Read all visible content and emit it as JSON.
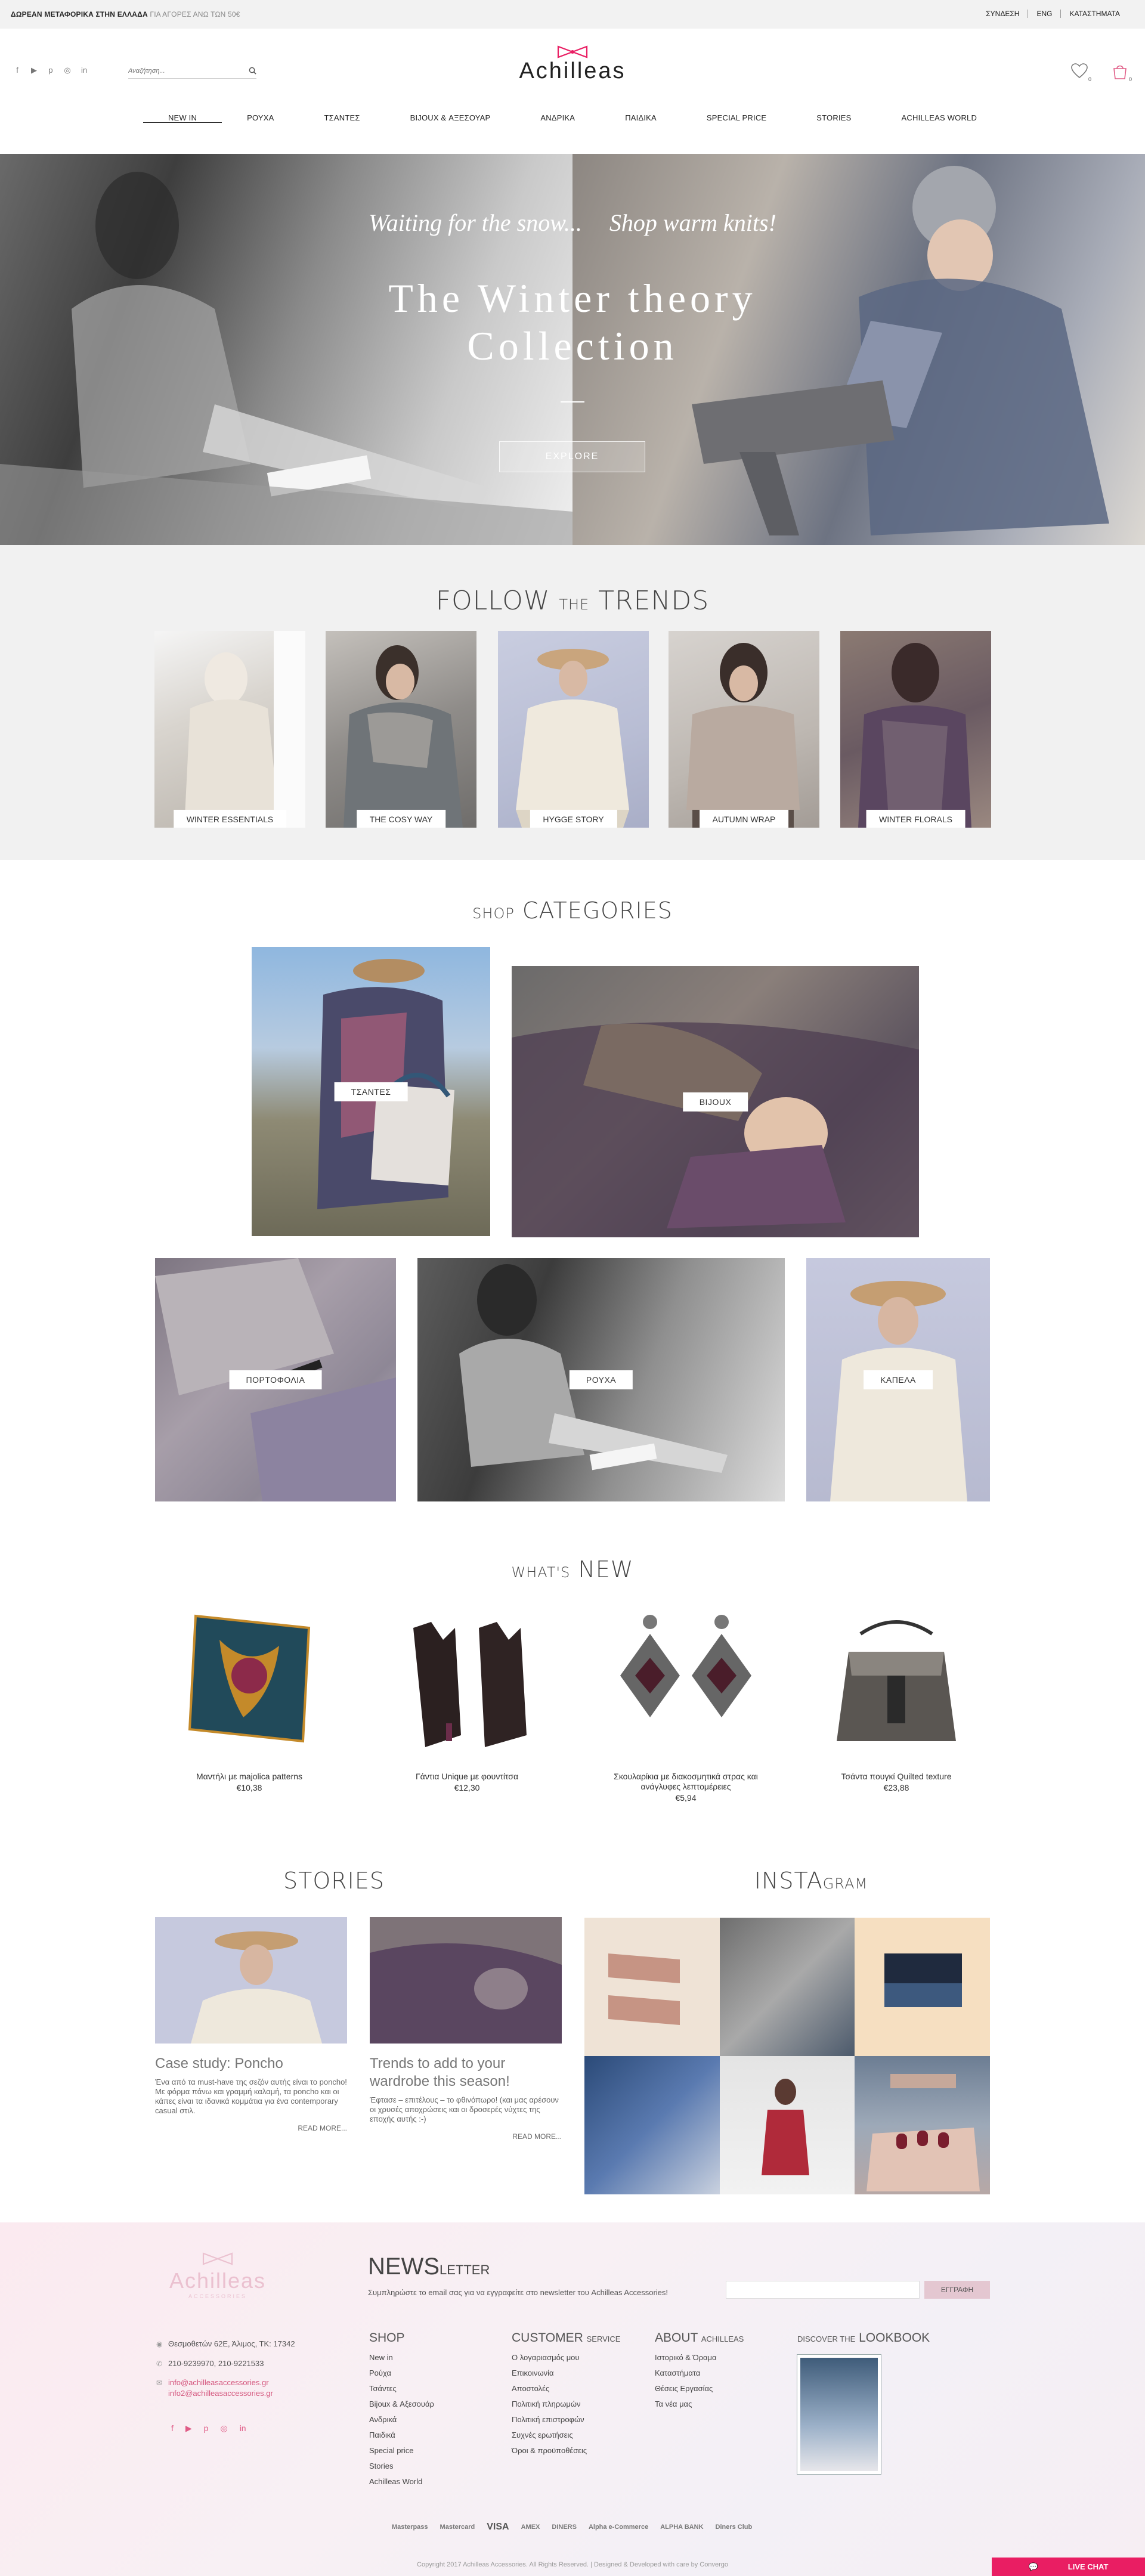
{
  "topbar": {
    "promo_bold": "ΔΩΡΕΑΝ ΜΕΤΑΦΟΡΙΚΑ ΣΤΗΝ ΕΛΛΑΔΑ",
    "promo_light": "ΓΙΑ ΑΓΟΡΕΣ ΑΝΩ ΤΩΝ 50€",
    "links": [
      "ΣΥΝΔΕΣΗ",
      "ENG",
      "ΚΑΤΑΣΤΗΜΑΤΑ"
    ]
  },
  "header": {
    "search_placeholder": "Αναζήτηση...",
    "logo_text": "Achilleas",
    "wishlist_count": "0",
    "cart_count": "0",
    "social_icons": [
      "facebook-icon",
      "youtube-icon",
      "pinterest-icon",
      "instagram-icon",
      "linkedin-icon"
    ],
    "nav": [
      "NEW IN",
      "ΡΟΥΧΑ",
      "ΤΣΑΝΤΕΣ",
      "BIJOUX & ΑΞΕΣΟΥΑΡ",
      "ΑΝΔΡΙΚΑ",
      "ΠΑΙΔΙΚΑ",
      "SPECIAL PRICE",
      "STORIES",
      "ACHILLEAS WORLD"
    ]
  },
  "hero": {
    "tagline_left": "Waiting for the snow...",
    "tagline_right": "Shop warm knits!",
    "title_line1": "The Winter theory",
    "title_line2": "Collection",
    "button": "EXPLORE"
  },
  "trends": {
    "title_big1": "FOLLOW",
    "title_small": "THE",
    "title_big2": "TRENDS",
    "cards": [
      "WINTER ESSENTIALS",
      "THE COSY WAY",
      "HYGGE STORY",
      "AUTUMN WRAP",
      "WINTER FLORALS"
    ]
  },
  "categories": {
    "title_small": "SHOP",
    "title_big": "CATEGORIES",
    "items": [
      "ΤΣΑΝΤΕΣ",
      "BIJOUX",
      "ΠΟΡΤΟΦΟΛΙΑ",
      "ΡΟΥΧΑ",
      "ΚΑΠΕΛΑ"
    ]
  },
  "whats_new": {
    "title_small": "WHAT'S",
    "title_big": "NEW",
    "products": [
      {
        "name": "Μαντήλι με majolica patterns",
        "price": "€10,38"
      },
      {
        "name": "Γάντια Unique με φουντίτσα",
        "price": "€12,30"
      },
      {
        "name": "Σκουλαρίκια με διακοσμητικά στρας και ανάγλυφες λεπτομέρειες",
        "price": "€5,94"
      },
      {
        "name": "Τσάντα πουγκί Quilted texture",
        "price": "€23,88"
      }
    ]
  },
  "stories": {
    "title": "STORIES",
    "items": [
      {
        "title": "Case study: Poncho",
        "excerpt": "Ένα από τα must-have της σεζόν αυτής είναι το poncho! Με φόρμα πάνω και γραμμή καλαμή, τα poncho και οι κάπες είναι τα ιδανικά κομμάτια για ένα contemporary casual στιλ.",
        "more": "READ MORE..."
      },
      {
        "title": "Trends to add to your wardrobe this season!",
        "excerpt": "Έφτασε – επιτέλους – το φθινόπωρο! (και μας αρέσουν οι χρυσές αποχρώσεις και οι δροσερές νύχτες της εποχής αυτής :-)",
        "more": "READ MORE..."
      }
    ]
  },
  "instagram": {
    "title_big": "INSTA",
    "title_small": "GRAM"
  },
  "footer": {
    "logo_text": "Achilleas",
    "logo_sub": "ACCESSORIES",
    "newsletter_big": "NEWS",
    "newsletter_small": "LETTER",
    "newsletter_text": "Συμπληρώστε το email σας για να εγγραφείτε στο newsletter του Achilleas Accessories!",
    "newsletter_button": "ΕΓΓΡΑΦΗ",
    "address": "Θεσμοθετών 62Ε, Άλιμος, ΤΚ: 17342",
    "phone": "210-9239970, 210-9221533",
    "email1": "info@achilleasaccessories.gr",
    "email2": "info2@achilleasaccessories.gr",
    "shop_title": "SHOP",
    "shop_links": [
      "New in",
      "Ρούχα",
      "Τσάντες",
      "Bijoux & Αξεσουάρ",
      "Ανδρικά",
      "Παιδικά",
      "Special price",
      "Stories",
      "Achilleas World"
    ],
    "customer_title_big": "CUSTOMER",
    "customer_title_small": "SERVICE",
    "customer_links": [
      "Ο λογαριασμός μου",
      "Επικοινωνία",
      "Αποστολές",
      "Πολιτική πληρωμών",
      "Πολιτική επιστροφών",
      "Συχνές ερωτήσεις",
      "Όροι & προϋποθέσεις"
    ],
    "about_title_big": "ABOUT",
    "about_title_small": "ACHILLEAS",
    "about_links": [
      "Ιστορικό & Όραμα",
      "Καταστήματα",
      "Θέσεις Εργασίας",
      "Τα νέα μας"
    ],
    "lookbook_small": "DISCOVER THE",
    "lookbook_big": "LOOKBOOK",
    "payments": [
      "Masterpass",
      "Mastercard",
      "VISA",
      "AMEX",
      "DINERS",
      "Alpha e-Commerce",
      "ALPHA BANK",
      "Diners Club"
    ],
    "copyright": "Copyright 2017 Achilleas Accessories. All Rights Reserved. | Designed & Developed with care by Convergo"
  },
  "livechat": "LIVE CHAT",
  "colors": {
    "accent_pink": "#e91e63",
    "footer_pink": "#d4547c"
  }
}
